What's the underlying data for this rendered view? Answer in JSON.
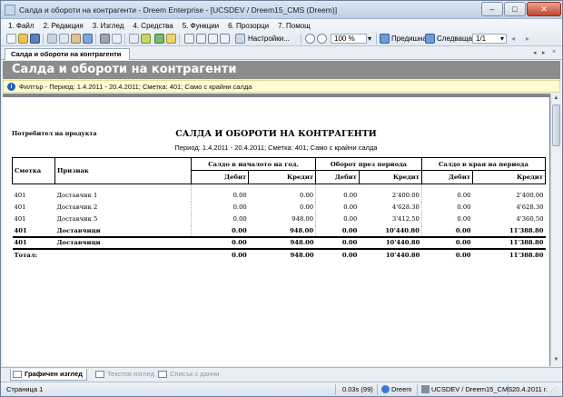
{
  "window": {
    "title": "Салда и обороти на контрагенти - Dreem Enterprise - [UCSDEV / Dreem15_CMS (Dreem)]",
    "min": "–",
    "max": "□",
    "close": "✕"
  },
  "menu": [
    "1. Файл",
    "2. Редакция",
    "3. Изглед",
    "4. Средства",
    "5. Функции",
    "6. Прозорци",
    "7. Помощ"
  ],
  "toolbar": {
    "settings_label": "Настройки...",
    "zoom_value": "100 %",
    "prev_label": "Предишна",
    "next_label": "Следваща",
    "page_value": "1/1"
  },
  "document_tab": "Салда и обороти на контрагенти",
  "heading": "Салда и обороти на контрагенти",
  "filter_text": "Филтър - Период: 1.4.2011 - 20.4.2011; Сметка: 401; Само с крайни салда",
  "report": {
    "left_label": "Потребител на продукта",
    "title": "САЛДА И ОБОРОТИ НА КОНТРАГЕНТИ",
    "subtitle": "Период: 1.4.2011 - 20.4.2011; Сметка: 401; Само с крайни салда",
    "headers": {
      "account": "Сметка",
      "attribute": "Признак",
      "opening": "Салдо в началото на год.",
      "turnover": "Оборот през периода",
      "closing": "Салдо в края на периода",
      "debit": "Дебит",
      "credit": "Кредит"
    },
    "rows": [
      {
        "account": "401",
        "name": "Доставчик 1",
        "od": "0.00",
        "oc": "0.00",
        "td": "0.00",
        "tc": "2'400.00",
        "cd": "0.00",
        "cc": "2'400.00"
      },
      {
        "account": "401",
        "name": "Доставчик 2",
        "od": "0.00",
        "oc": "0.00",
        "td": "0.00",
        "tc": "4'628.30",
        "cd": "0.00",
        "cc": "4'628.30"
      },
      {
        "account": "401",
        "name": "Доставчик 5",
        "od": "0.00",
        "oc": "948.00",
        "td": "0.00",
        "tc": "3'412.50",
        "cd": "0.00",
        "cc": "4'360.50"
      },
      {
        "account": "401",
        "name": "Доставчици",
        "od": "0.00",
        "oc": "948.00",
        "td": "0.00",
        "tc": "10'440.80",
        "cd": "0.00",
        "cc": "11'388.80"
      }
    ],
    "group": {
      "account": "401",
      "name": "Доставчици",
      "od": "0.00",
      "oc": "948.00",
      "td": "0.00",
      "tc": "10'440.80",
      "cd": "0.00",
      "cc": "11'388.80"
    },
    "total": {
      "label": "Тотал:",
      "od": "0.00",
      "oc": "948.00",
      "td": "0.00",
      "tc": "10'440.80",
      "cd": "0.00",
      "cc": "11'388.80"
    }
  },
  "view_tabs": [
    "Графичен изглед",
    "Текстов изглед",
    "Списък с данни"
  ],
  "status": {
    "page": "Страница 1",
    "time": "0.03s (99)",
    "user": "Dreem",
    "db": "UCSDEV / Dreem15_CMS",
    "date": "20.4.2011 г."
  }
}
